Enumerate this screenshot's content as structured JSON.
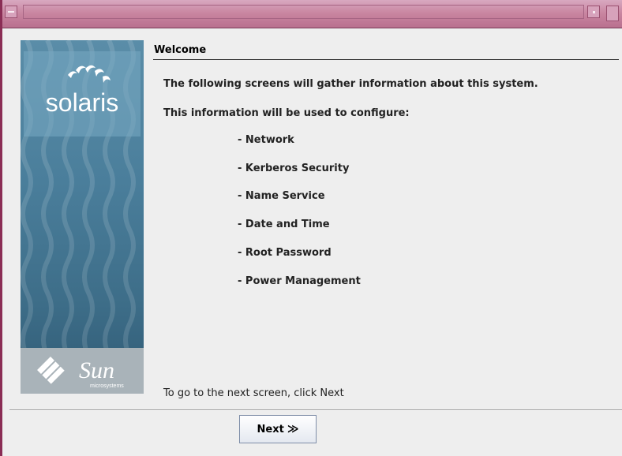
{
  "window": {
    "title": ""
  },
  "brand": {
    "product_logo": "solaris",
    "company_logo": "Sun",
    "company_sub": "microsystems"
  },
  "page": {
    "title": "Welcome",
    "intro": "The following screens will gather information about this system.",
    "configure_heading": "This information will be used to configure:",
    "items": [
      "- Network",
      "- Kerberos Security",
      "- Name Service",
      "- Date and Time",
      "- Root Password",
      "- Power Management"
    ],
    "footer_hint": "To go to the next screen, click Next"
  },
  "buttons": {
    "next_label": "Next",
    "next_icon": "double-chevron-right-icon"
  },
  "colors": {
    "titlebar": "#c8849f",
    "panel_top": "#5a8da8",
    "panel_bottom": "#2f5a74"
  }
}
